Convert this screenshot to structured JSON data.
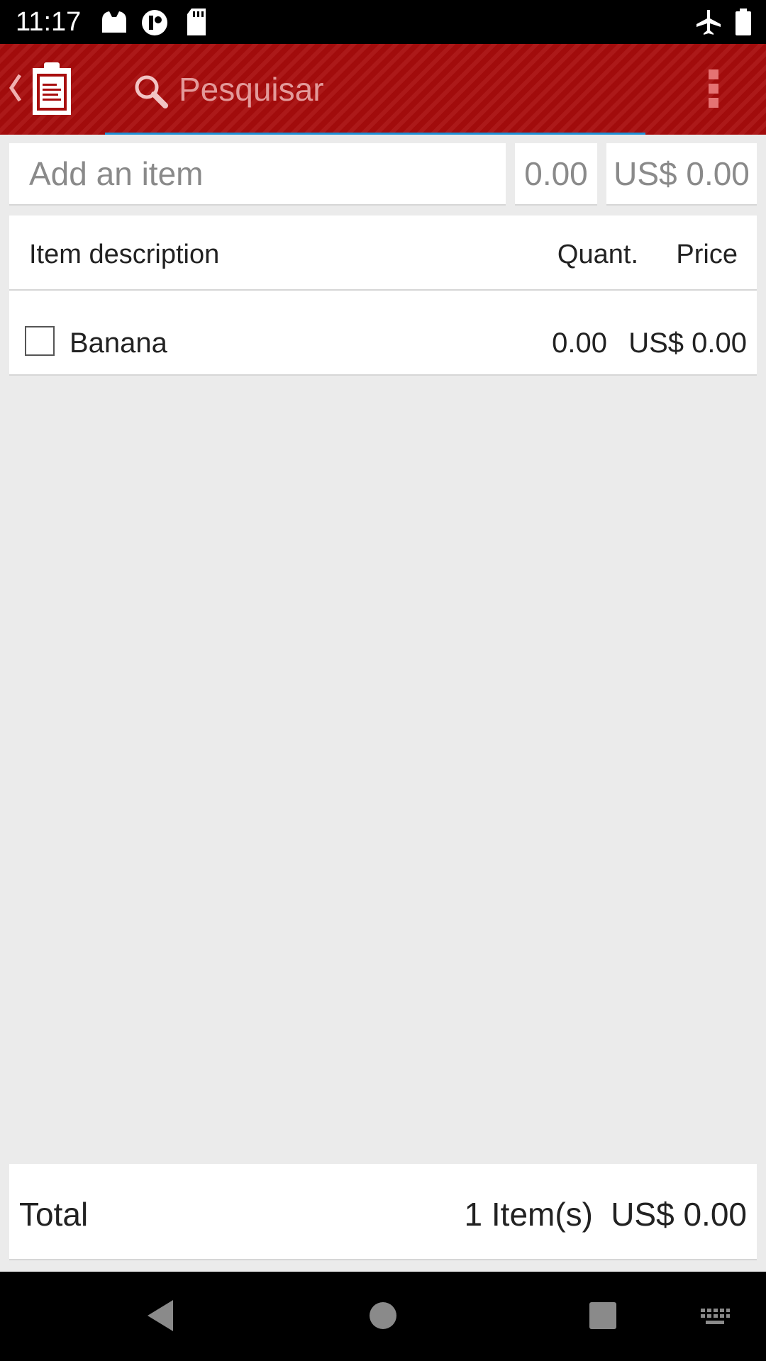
{
  "status_bar": {
    "time": "11:17",
    "left_icons": [
      "cat-face-icon",
      "circle-badge-icon",
      "sd-card-icon"
    ],
    "right_icons": [
      "airplane-mode-icon",
      "battery-icon"
    ]
  },
  "toolbar": {
    "search_placeholder": "Pesquisar",
    "background_color": "#a80d0d",
    "underline_color": "#1e90d6"
  },
  "add_item": {
    "name_placeholder": "Add an item",
    "quantity_placeholder": "0.00",
    "price_placeholder": "US$ 0.00"
  },
  "list": {
    "columns": {
      "description": "Item description",
      "quantity": "Quant.",
      "price": "Price"
    },
    "items": [
      {
        "name": "Banana",
        "quantity": "0.00",
        "price": "US$ 0.00",
        "checked": false
      }
    ]
  },
  "total": {
    "label": "Total",
    "count": "1 Item(s)",
    "amount": "US$ 0.00"
  },
  "nav_bar": {
    "buttons": [
      "back-icon",
      "home-icon",
      "recents-icon",
      "keyboard-icon"
    ]
  }
}
